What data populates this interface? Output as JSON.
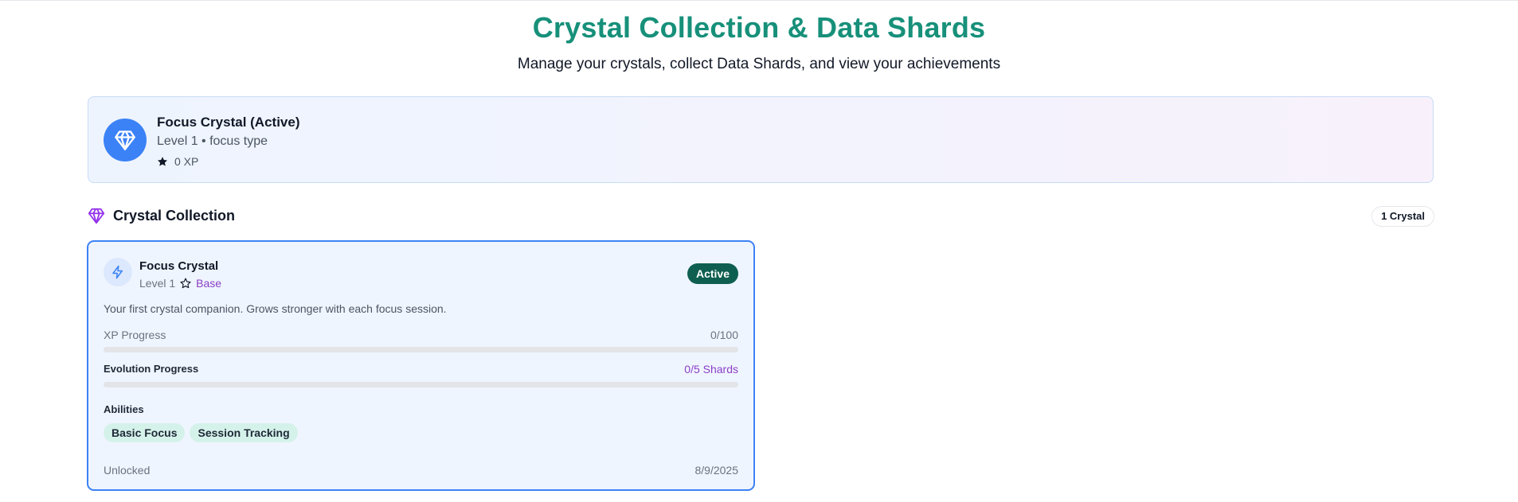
{
  "header": {
    "title": "Crystal Collection & Data Shards",
    "subtitle": "Manage your crystals, collect Data Shards, and view your achievements"
  },
  "active_crystal": {
    "name": "Focus Crystal (Active)",
    "level_type": "Level 1 • focus type",
    "xp": "0 XP",
    "icon": "gem-icon",
    "accent": "#3b82f6"
  },
  "collection": {
    "title": "Crystal Collection",
    "count_label": "1 Crystal",
    "icon": "gem-icon",
    "icon_color": "#9333ea"
  },
  "crystals": [
    {
      "name": "Focus Crystal",
      "level": "Level 1",
      "rarity": "Base",
      "status": "Active",
      "description": "Your first crystal companion. Grows stronger with each focus session.",
      "xp_label": "XP Progress",
      "xp_value": "0/100",
      "xp_fraction": 0,
      "evolution_label": "Evolution Progress",
      "evolution_value": "0/5 Shards",
      "evolution_fraction": 0,
      "abilities_title": "Abilities",
      "abilities": [
        "Basic Focus",
        "Session Tracking"
      ],
      "unlocked_label": "Unlocked",
      "unlocked_date": "8/9/2025",
      "icon": "bolt-icon"
    }
  ],
  "colors": {
    "title": "#17907a",
    "active_badge": "#0f5f50",
    "rarity": "#8b3fc8",
    "card_border": "#3b82f6",
    "ability_chip": "#d5f2ea"
  }
}
